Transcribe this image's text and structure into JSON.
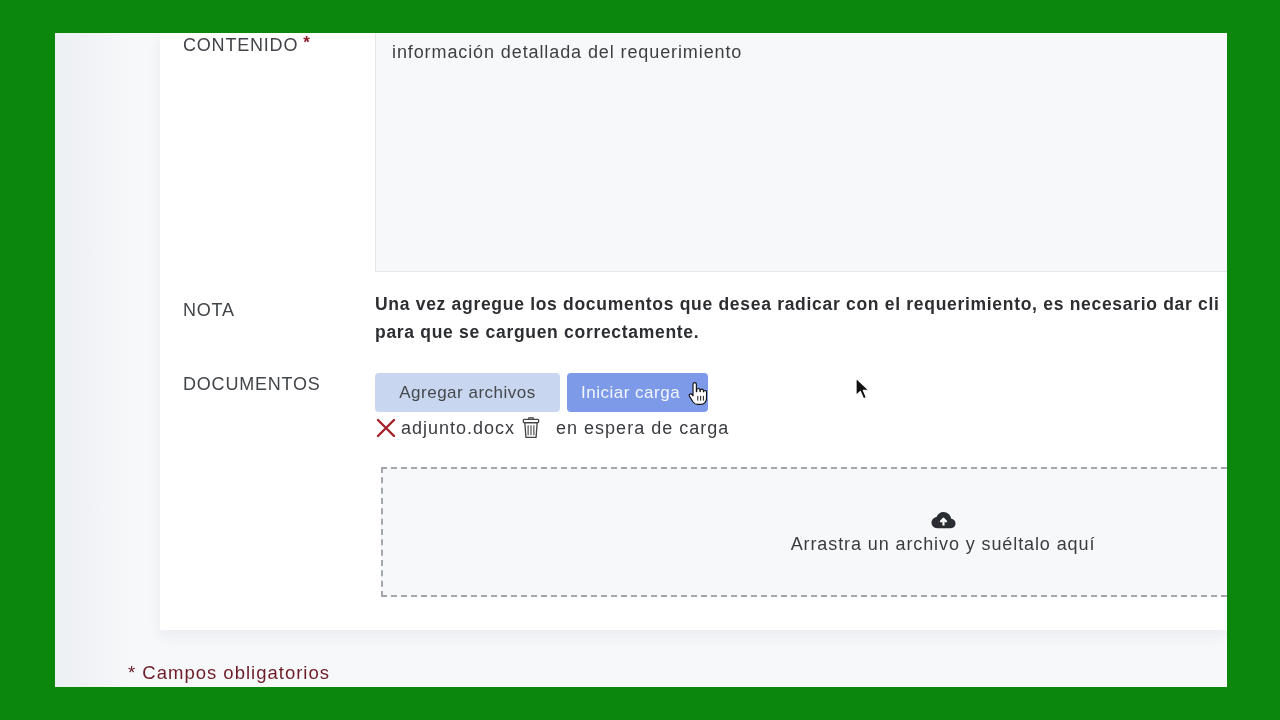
{
  "form": {
    "fields": [
      {
        "kind": "textarea",
        "label": "CONTENIDO",
        "required_mark": "*",
        "value": "información detallada del requerimiento"
      },
      {
        "kind": "note",
        "label": "NOTA",
        "lines": [
          "Una vez agregue los documentos que desea radicar con el requerimiento, es necesario dar cli",
          "para que se carguen correctamente."
        ]
      },
      {
        "kind": "documents",
        "label": "DOCUMENTOS",
        "buttons": [
          {
            "label": "Agregar archivos",
            "kind": "secondary",
            "disabled": false
          },
          {
            "label": "Iniciar carga",
            "kind": "primary",
            "disabled": true
          }
        ],
        "files": [
          {
            "name": "adjunto.docx",
            "status": "en espera de carga"
          }
        ],
        "dropzone": {
          "text": "Arrastra un archivo y suéltalo aquí"
        }
      }
    ]
  },
  "footnote": "* Campos obligatorios"
}
